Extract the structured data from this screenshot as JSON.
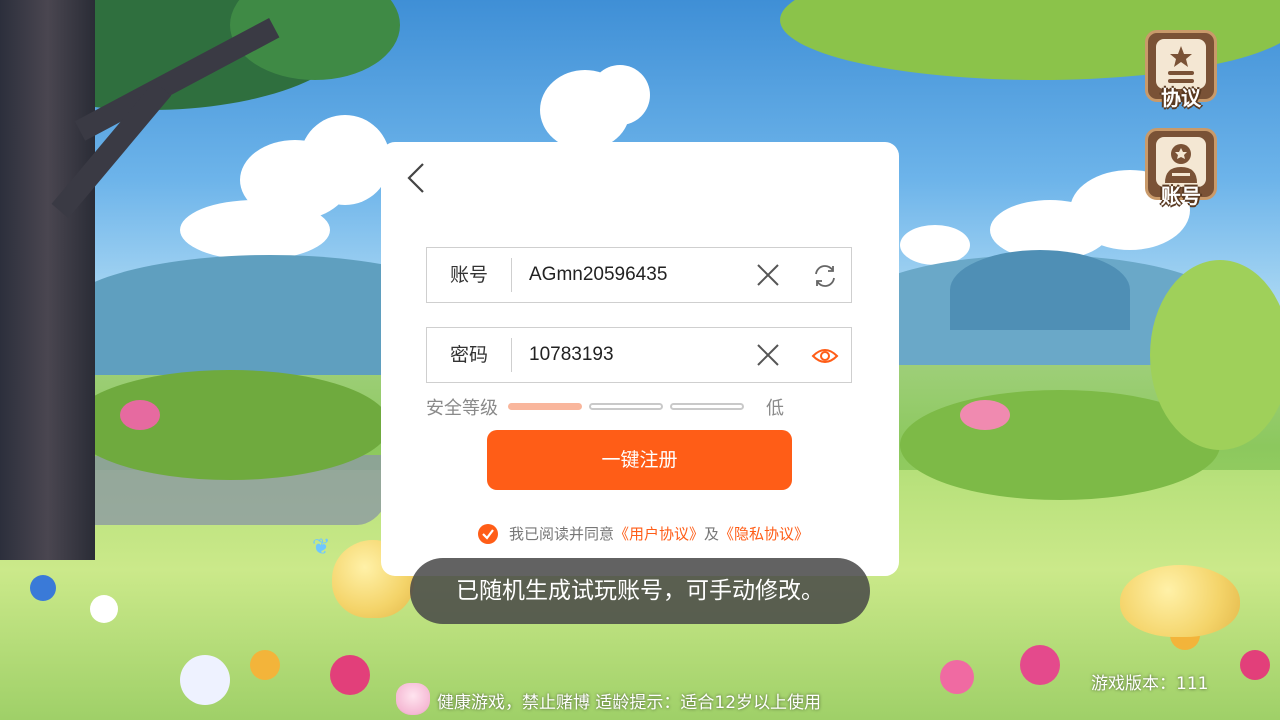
{
  "side_buttons": {
    "agreement_label": "协议",
    "account_label": "账号"
  },
  "form": {
    "account_label": "账号",
    "account_value": "AGmn20596435",
    "password_label": "密码",
    "password_value": "10783193",
    "strength_label": "安全等级",
    "strength_level": "低",
    "strength_filled": 1,
    "strength_total": 3,
    "register_button": "一键注册",
    "agree_prefix": "我已阅读并同意",
    "user_agreement": "《用户协议》",
    "agree_and": "及",
    "privacy_agreement": "《隐私协议》",
    "agree_checked": true
  },
  "toast": {
    "message": "已随机生成试玩账号，可手动修改。"
  },
  "footer": {
    "health_notice": "健康游戏，禁止赌博  适龄提示：适合12岁以上使用",
    "version": "游戏版本：111"
  },
  "colors": {
    "accent": "#ff5d17",
    "strength_on": "#f9b69c"
  }
}
